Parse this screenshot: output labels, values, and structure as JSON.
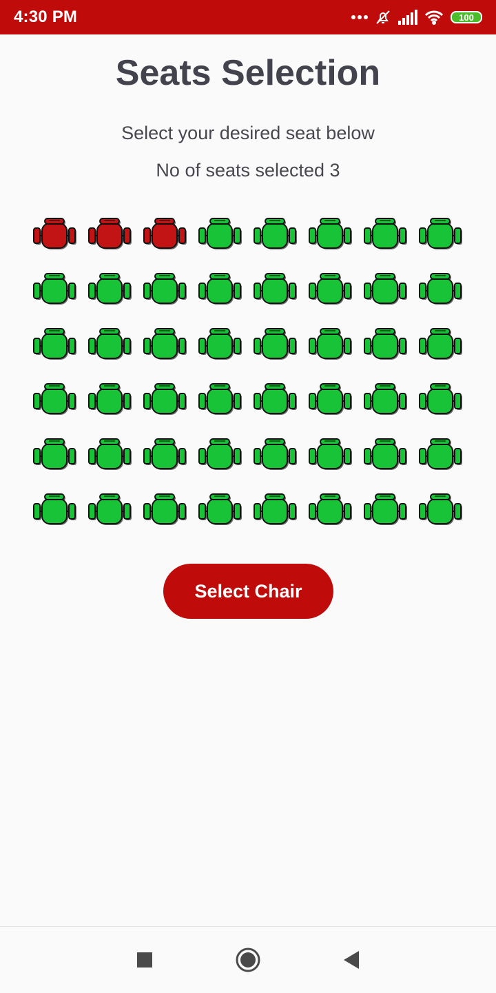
{
  "status_bar": {
    "time": "4:30 PM",
    "battery": "100",
    "icons": [
      "more-dots-icon",
      "bell-off-icon",
      "signal-icon",
      "wifi-icon",
      "battery-icon"
    ]
  },
  "title": "Seats Selection",
  "subtitle": "Select your desired seat below",
  "seats_selected_text": "No of seats selected 3",
  "seats_selected_count": 3,
  "seat_grid": {
    "rows": 6,
    "columns": 8,
    "selected_color": "#c21414",
    "available_color": "#19c337",
    "selected_seats": [
      [
        0,
        0
      ],
      [
        0,
        1
      ],
      [
        0,
        2
      ]
    ]
  },
  "select_button": {
    "label": "Select Chair"
  },
  "colors": {
    "accent": "#c00b0b",
    "title": "#43434d",
    "text": "#47474f"
  },
  "nav_bar": {
    "icons": [
      "recents-square-icon",
      "home-circle-icon",
      "back-triangle-icon"
    ]
  }
}
